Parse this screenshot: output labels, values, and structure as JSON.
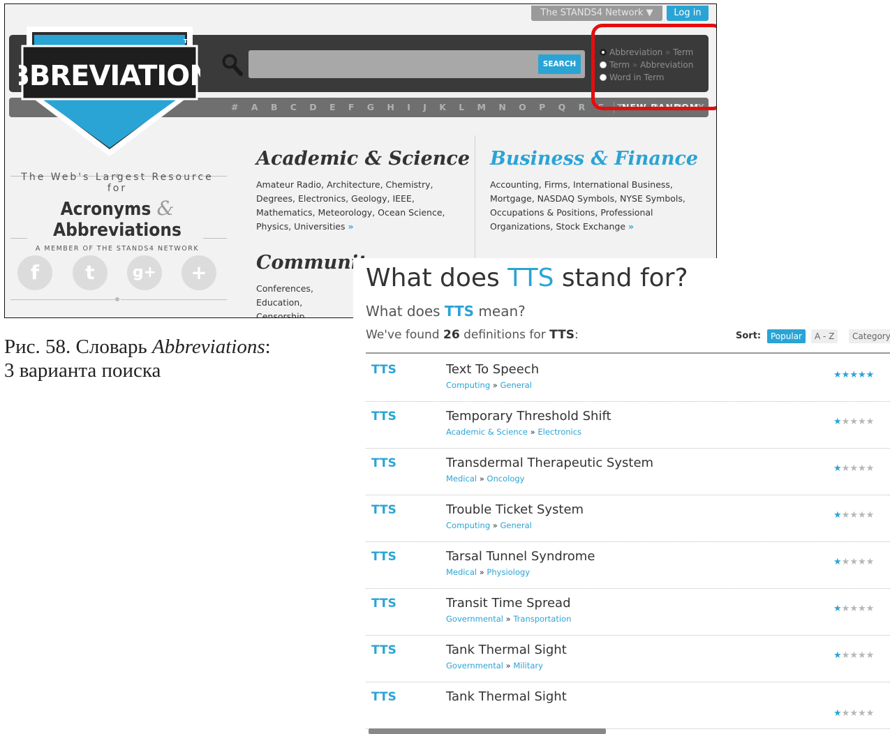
{
  "site": {
    "network_label": "The STANDS4 Network ▼",
    "login_label": "Log in",
    "search_button": "SEARCH",
    "logo_text": "ABBREVIATIONS",
    "logo_tm": "TM",
    "search_modes": [
      {
        "a": "Abbreviation",
        "b": "Term",
        "selected": true
      },
      {
        "a": "Term",
        "b": "Abbreviation",
        "selected": false
      },
      {
        "a": "Word in Term",
        "b": "",
        "selected": false
      }
    ],
    "alphabet": "# A B C D E F G H I J K L M N O P Q R S T U V W X Y Z",
    "alpha_extra": "NEW  RANDOM",
    "tagline_1": "The Web's Largest Resource for",
    "tagline_2a": "Acronyms",
    "tagline_amp": "&",
    "tagline_2b": "Abbreviations",
    "tagline_3": "A MEMBER OF THE STANDS4 NETWORK",
    "social": [
      "f",
      "t",
      "g+",
      "+"
    ],
    "categories": [
      {
        "title": "Academic & Science",
        "color": "#333333",
        "text": "Amateur Radio, Architecture, Chemistry, Degrees, Electronics, Geology, IEEE, Mathematics, Meteorology, Ocean Science, Physics, Universities",
        "more": "»"
      },
      {
        "title": "Business & Finance",
        "color": "#2aa4d5",
        "text": "Accounting, Firms, International Business, Mortgage, NASDAQ Symbols, NYSE Symbols, Occupations & Positions, Professional Organizations, Stock Exchange",
        "more": "»"
      },
      {
        "title": "Community",
        "color": "#333333",
        "text": "Conferences, Education, Censorship, Genealogy, Museums, Music, Non-",
        "more": ""
      }
    ]
  },
  "caption": {
    "prefix": "Рис. 58. Словарь ",
    "italic": "Abbreviations",
    "suffix": ":",
    "line2": "3 варианта поиска"
  },
  "results": {
    "title_pre": "What does ",
    "title_term": "TTS",
    "title_post": " stand for?",
    "sub_pre": "What does ",
    "sub_term": "TTS",
    "sub_post": " mean?",
    "found_pre": "We've found ",
    "found_count": "26",
    "found_mid": " definitions for ",
    "found_term": "TTS",
    "found_post": ":",
    "sort_label": "Sort:",
    "sort_options": [
      "Popular",
      "A - Z",
      "Category"
    ],
    "rows": [
      {
        "abbr": "TTS",
        "term": "Text To Speech",
        "cat1": "Computing",
        "cat2": "General",
        "rating": 5
      },
      {
        "abbr": "TTS",
        "term": "Temporary Threshold Shift",
        "cat1": "Academic & Science",
        "cat2": "Electronics",
        "rating": 1
      },
      {
        "abbr": "TTS",
        "term": "Transdermal Therapeutic System",
        "cat1": "Medical",
        "cat2": "Oncology",
        "rating": 1
      },
      {
        "abbr": "TTS",
        "term": "Trouble Ticket System",
        "cat1": "Computing",
        "cat2": "General",
        "rating": 1
      },
      {
        "abbr": "TTS",
        "term": "Tarsal Tunnel Syndrome",
        "cat1": "Medical",
        "cat2": "Physiology",
        "rating": 1
      },
      {
        "abbr": "TTS",
        "term": "Transit Time Spread",
        "cat1": "Governmental",
        "cat2": "Transportation",
        "rating": 1
      },
      {
        "abbr": "TTS",
        "term": "Tank Thermal Sight",
        "cat1": "Governmental",
        "cat2": "Military",
        "rating": 1
      },
      {
        "abbr": "TTS",
        "term": "Tank Thermal Sight",
        "cat1": "",
        "cat2": "",
        "rating": 1
      }
    ],
    "colors": {
      "accent": "#2aa4d5",
      "highlight": "#e50d0d"
    }
  }
}
